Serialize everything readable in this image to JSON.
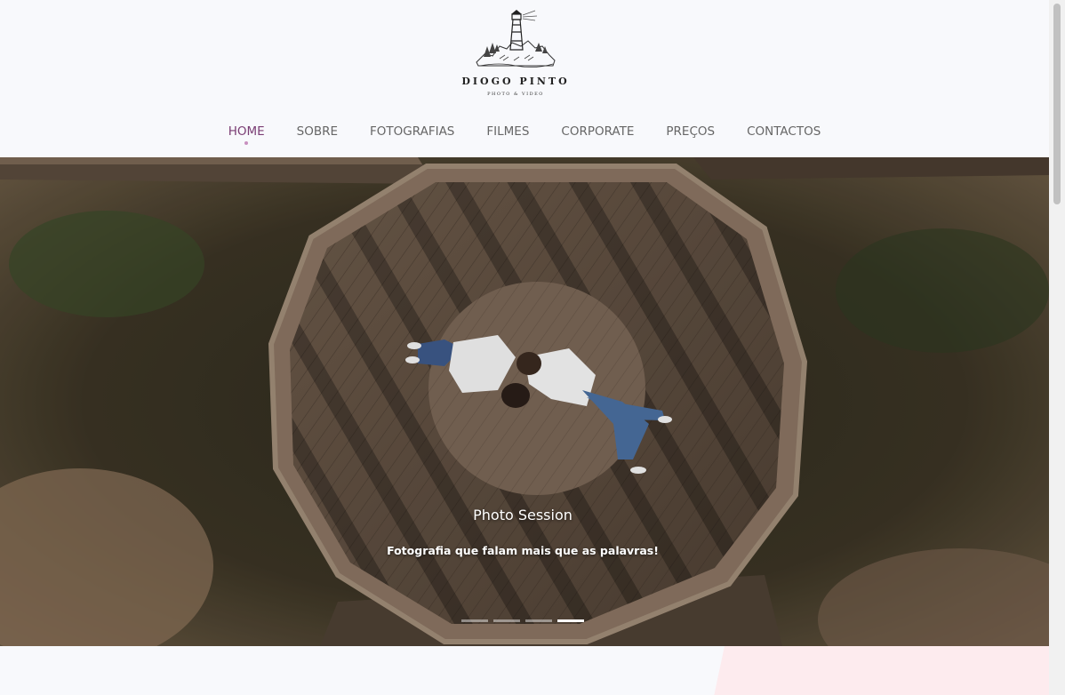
{
  "logo": {
    "name": "DIOGO PINTO",
    "subtitle": "PHOTO & VIDEO"
  },
  "nav": {
    "items": [
      {
        "label": "HOME"
      },
      {
        "label": "SOBRE"
      },
      {
        "label": "FOTOGRAFIAS"
      },
      {
        "label": "FILMES"
      },
      {
        "label": "CORPORATE"
      },
      {
        "label": "PREÇOS"
      },
      {
        "label": "CONTACTOS"
      }
    ],
    "active_index": 0
  },
  "hero": {
    "title": "Photo Session",
    "subtitle": "Fotografia que falam mais que as palavras!",
    "slides_total": 4,
    "active_slide": 4
  },
  "colors": {
    "accent": "#7a3d74",
    "nav_text": "#666666",
    "background": "#f8f9fc",
    "pink_band": "#fdebee"
  },
  "icons": {
    "logo": "lighthouse-logo-icon"
  }
}
